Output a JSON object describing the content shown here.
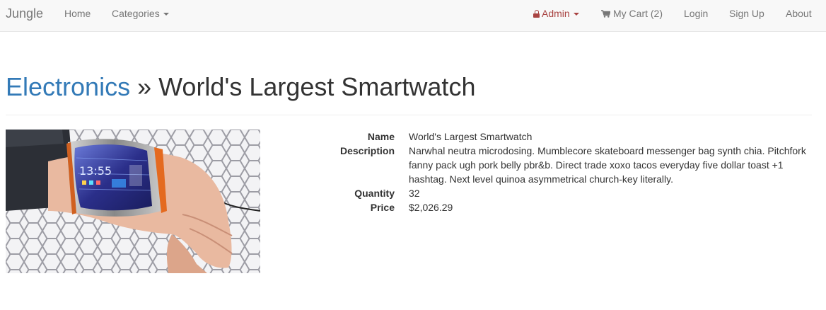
{
  "navbar": {
    "brand": "Jungle",
    "home": "Home",
    "categories": "Categories",
    "admin": "Admin",
    "cart": "My Cart (2)",
    "login": "Login",
    "signup": "Sign Up",
    "about": "About"
  },
  "page": {
    "category": "Electronics",
    "separator": " » ",
    "product_title": "World's Largest Smartwatch"
  },
  "product": {
    "labels": {
      "name": "Name",
      "description": "Description",
      "quantity": "Quantity",
      "price": "Price"
    },
    "name": "World's Largest Smartwatch",
    "description": "Narwhal neutra microdosing. Mumblecore skateboard messenger bag synth chia. Pitchfork fanny pack ugh pork belly pbr&b. Direct trade xoxo tacos everyday five dollar toast +1 hashtag. Next level quinoa asymmetrical church-key literally.",
    "quantity": "32",
    "price": "$2,026.29"
  },
  "colors": {
    "link": "#337ab7",
    "admin": "#a94442",
    "nav_text": "#777777",
    "navbar_bg": "#f8f8f8"
  },
  "icons": {
    "admin": "lock-icon",
    "cart": "shopping-cart-icon",
    "dropdown": "caret-down-icon"
  }
}
